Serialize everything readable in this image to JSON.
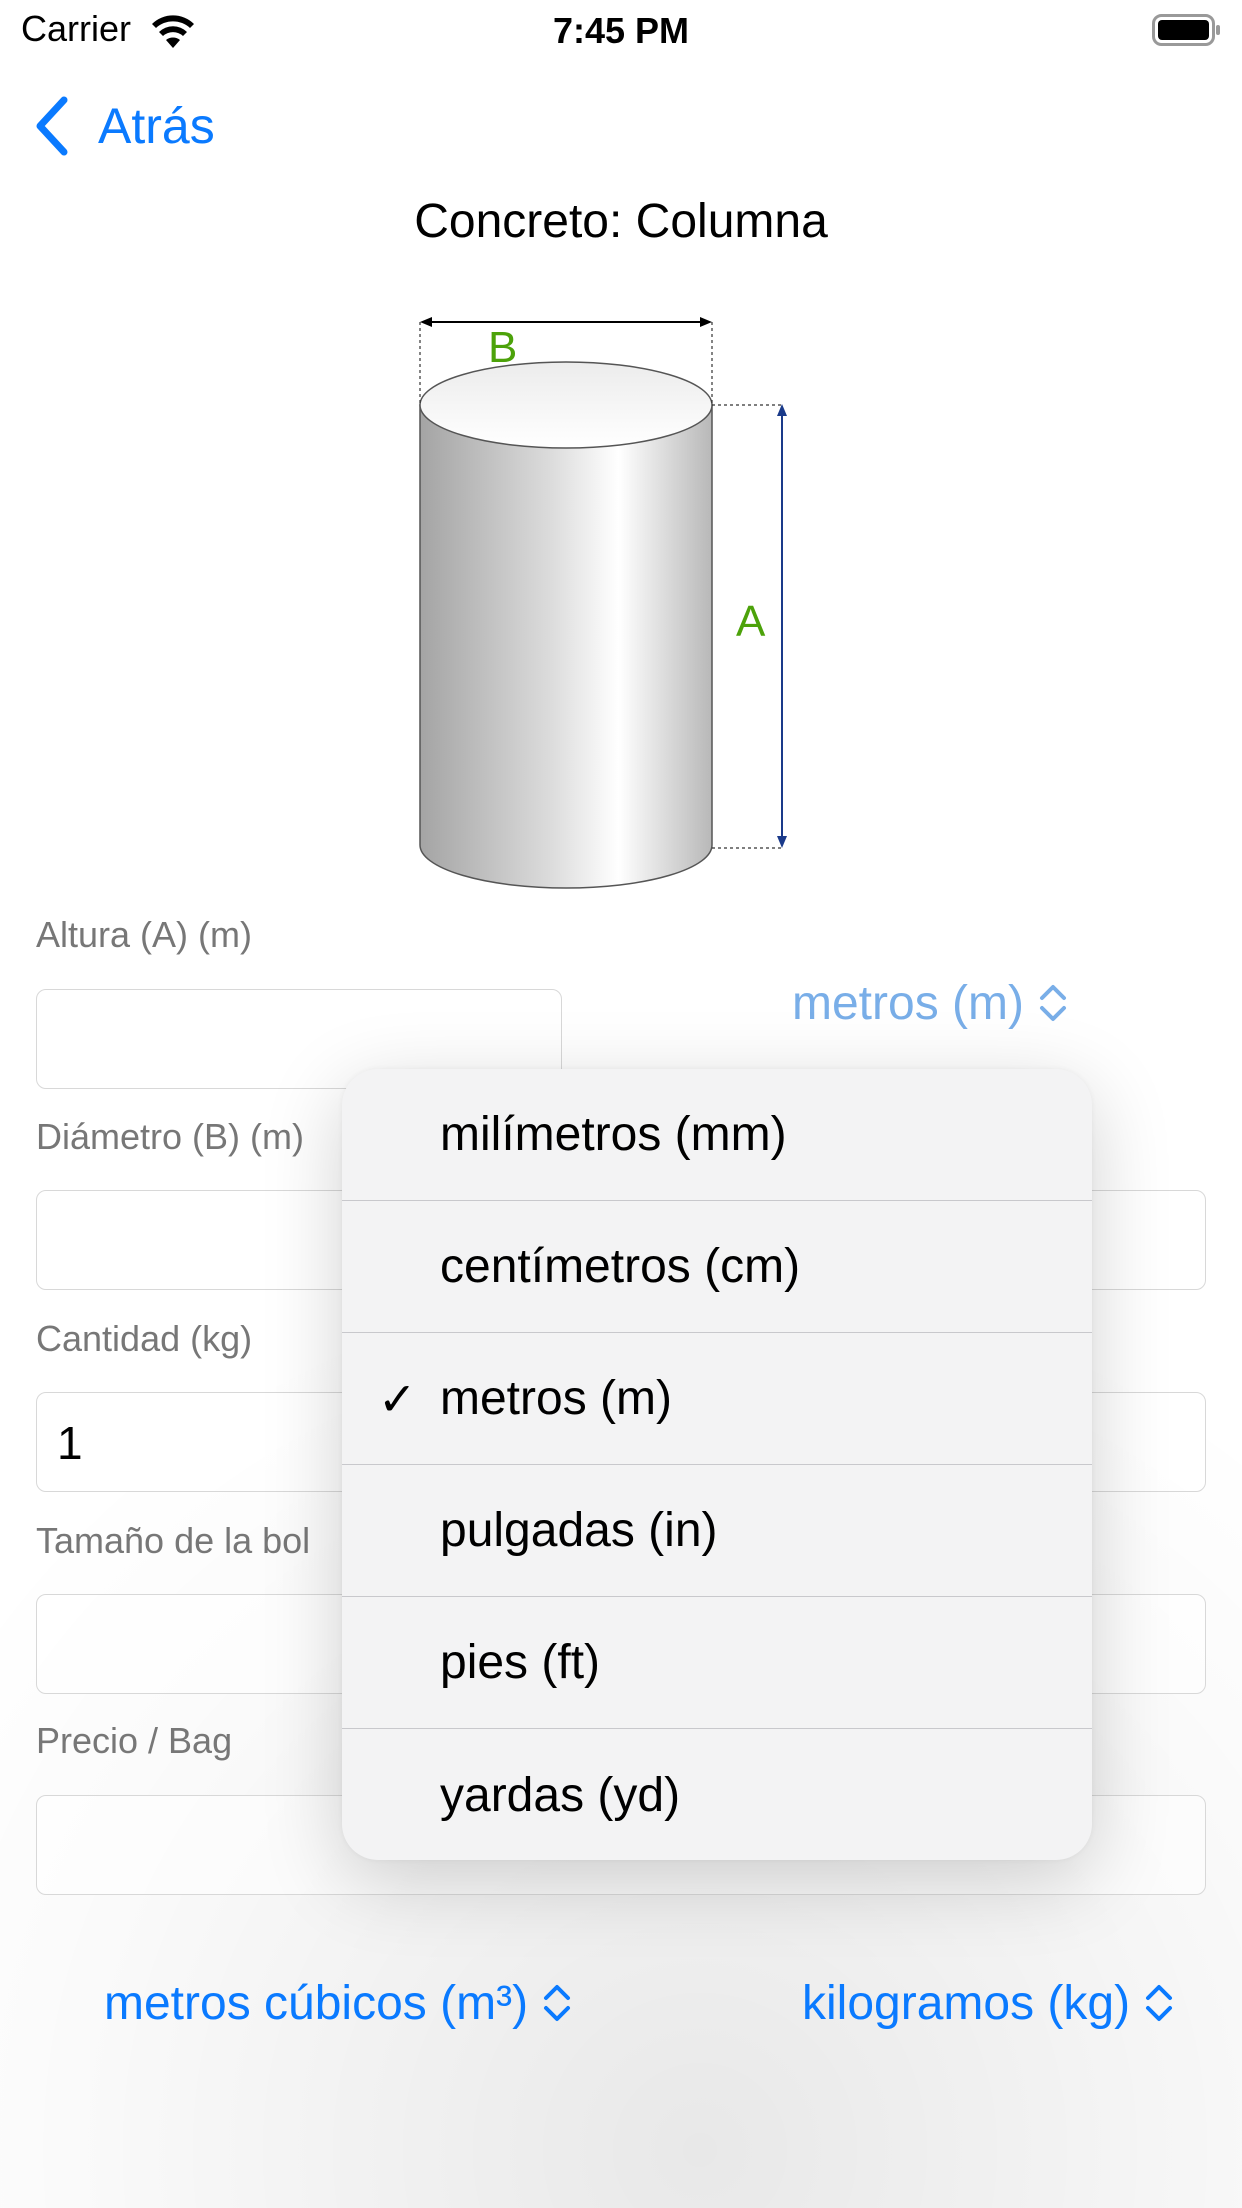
{
  "status_bar": {
    "carrier": "Carrier",
    "time": "7:45 PM"
  },
  "nav": {
    "back_label": "Atrás",
    "title": "Concreto: Columna"
  },
  "diagram": {
    "label_b": "B",
    "label_a": "A",
    "label_color": "#4ca20a"
  },
  "form": {
    "altura_label": "Altura (A) (m)",
    "altura_value": "",
    "altura_unit": "metros (m)",
    "diametro_label": "Diámetro (B) (m)",
    "diametro_value": "",
    "cantidad_label": "Cantidad (kg)",
    "cantidad_value": "1",
    "bolsa_label": "Tamaño de la bol",
    "bolsa_value": "",
    "precio_label": "Precio / Bag",
    "precio_value": ""
  },
  "bottom": {
    "volume_unit": "metros cúbicos (m³)",
    "weight_unit": "kilogramos (kg)"
  },
  "menu": {
    "items": [
      {
        "label": "milímetros (mm)",
        "check": ""
      },
      {
        "label": "centímetros (cm)",
        "check": ""
      },
      {
        "label": "metros (m)",
        "check": "✓"
      },
      {
        "label": "pulgadas (in)",
        "check": ""
      },
      {
        "label": "pies (ft)",
        "check": ""
      },
      {
        "label": "yardas (yd)",
        "check": ""
      }
    ],
    "selected_index": 2
  },
  "colors": {
    "accent": "#0a7aff",
    "accent_dimmed": "#79aee8",
    "label_gray": "#777777"
  }
}
